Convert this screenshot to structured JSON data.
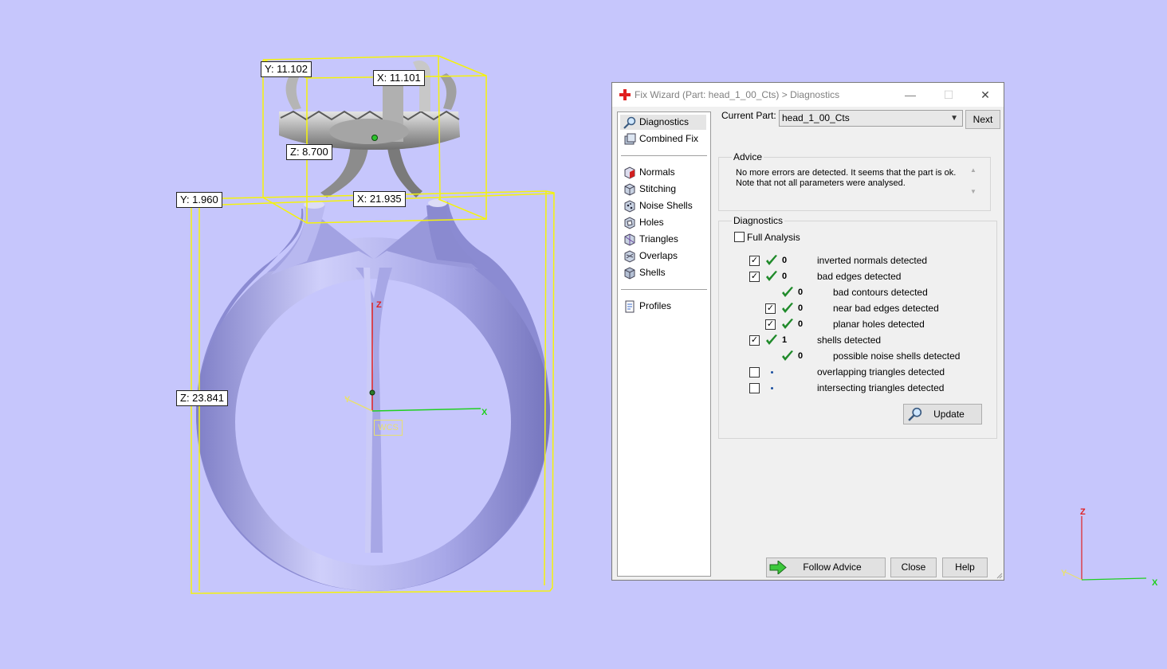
{
  "viewport": {
    "background": "#c6c6fc",
    "dimensions": {
      "top_y": "Y: 11.102",
      "top_x": "X: 11.101",
      "top_z": "Z: 8.700",
      "ring_y": "Y: 1.960",
      "ring_x": "X: 21.935",
      "ring_z": "Z: 23.841"
    },
    "wcs_label": "WCS",
    "axes": {
      "z": "Z",
      "x": "X",
      "y": "Y"
    },
    "small_axes": {
      "z": "Z",
      "x": "X",
      "y": "Y"
    }
  },
  "dialog": {
    "title": "Fix Wizard (Part: head_1_00_Cts) > Diagnostics",
    "window_buttons": {
      "minimize": "—",
      "maximize": "☐",
      "close": "✕"
    },
    "nav": {
      "top": [
        {
          "label": "Diagnostics",
          "icon": "magnifier-icon",
          "selected": true
        },
        {
          "label": "Combined Fix",
          "icon": "combined-fix-icon"
        }
      ],
      "fixes": [
        {
          "label": "Normals",
          "icon": "normals-icon"
        },
        {
          "label": "Stitching",
          "icon": "stitching-icon"
        },
        {
          "label": "Noise Shells",
          "icon": "noise-shells-icon"
        },
        {
          "label": "Holes",
          "icon": "holes-icon"
        },
        {
          "label": "Triangles",
          "icon": "triangles-icon"
        },
        {
          "label": "Overlaps",
          "icon": "overlaps-icon"
        },
        {
          "label": "Shells",
          "icon": "shells-icon"
        }
      ],
      "bottom": [
        {
          "label": "Profiles",
          "icon": "profiles-icon"
        }
      ]
    },
    "current_part_label": "Current Part:",
    "current_part_value": "head_1_00_Cts",
    "next_button": "Next",
    "advice": {
      "title": "Advice",
      "text": "No more errors are detected. It seems that the part is ok.\nNote that not all parameters were analysed."
    },
    "diagnostics": {
      "title": "Diagnostics",
      "full_analysis_label": "Full Analysis",
      "full_analysis_checked": false,
      "rows": [
        {
          "checkbox": true,
          "checked": true,
          "status": "ok",
          "count": "0",
          "label": "inverted normals detected",
          "indent": 0
        },
        {
          "checkbox": true,
          "checked": true,
          "status": "ok",
          "count": "0",
          "label": "bad edges detected",
          "indent": 0
        },
        {
          "checkbox": false,
          "checked": false,
          "status": "ok",
          "count": "0",
          "label": "bad contours detected",
          "indent": 1
        },
        {
          "checkbox": true,
          "checked": true,
          "status": "ok",
          "count": "0",
          "label": "near bad edges detected",
          "indent": 1
        },
        {
          "checkbox": true,
          "checked": true,
          "status": "ok",
          "count": "0",
          "label": "planar holes detected",
          "indent": 1
        },
        {
          "checkbox": true,
          "checked": true,
          "status": "ok",
          "count": "1",
          "label": "shells detected",
          "indent": 0
        },
        {
          "checkbox": false,
          "checked": false,
          "status": "ok",
          "count": "0",
          "label": "possible noise shells detected",
          "indent": 1
        },
        {
          "checkbox": true,
          "checked": false,
          "status": "pending",
          "count": "",
          "label": "overlapping triangles detected",
          "indent": 0
        },
        {
          "checkbox": true,
          "checked": false,
          "status": "pending",
          "count": "",
          "label": "intersecting triangles detected",
          "indent": 0
        }
      ],
      "update_button": "Update"
    },
    "follow_advice_button": "Follow Advice",
    "close_button": "Close",
    "help_button": "Help"
  }
}
